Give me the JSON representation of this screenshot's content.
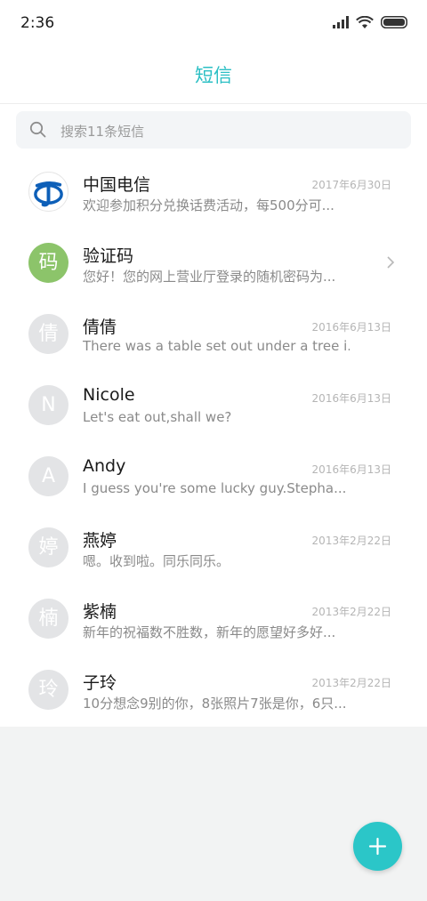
{
  "status_bar": {
    "time": "2:36"
  },
  "header": {
    "title": "短信"
  },
  "search": {
    "placeholder": "搜索11条短信"
  },
  "conversations": [
    {
      "name": "中国电信",
      "preview": "欢迎参加积分兑换话费活动，每500分可...",
      "date": "2017年6月30日",
      "avatar": "telecom-logo"
    },
    {
      "name": "验证码",
      "preview": "您好！您的网上营业厅登录的随机密码为...",
      "avatar_char": "码",
      "avatar_color": "#8cc46a"
    },
    {
      "name": "倩倩",
      "preview": "There was a table set out under a tree i...",
      "date": "2016年6月13日",
      "avatar_char": "倩"
    },
    {
      "name": "Nicole",
      "preview": "Let's eat out,shall we?",
      "date": "2016年6月13日",
      "avatar_char": "N"
    },
    {
      "name": "Andy",
      "preview": "I guess you're some lucky guy.Stepha...",
      "date": "2016年6月13日",
      "avatar_char": "A"
    },
    {
      "name": "燕婷",
      "preview": "嗯。收到啦。同乐同乐。",
      "date": "2013年2月22日",
      "avatar_char": "婷"
    },
    {
      "name": "紫楠",
      "preview": "新年的祝福数不胜数，新年的愿望好多好...",
      "date": "2013年2月22日",
      "avatar_char": "楠"
    },
    {
      "name": "子玲",
      "preview": "10分想念9别的你，8张照片7张是你，6只...",
      "date": "2013年2月22日",
      "avatar_char": "玲"
    }
  ],
  "colors": {
    "accent": "#2bbfc4",
    "fab": "#2bc6c8",
    "avatar_gray": "#e3e4e6",
    "avatar_green": "#8cc46a"
  },
  "fab": {
    "icon": "plus-icon"
  }
}
